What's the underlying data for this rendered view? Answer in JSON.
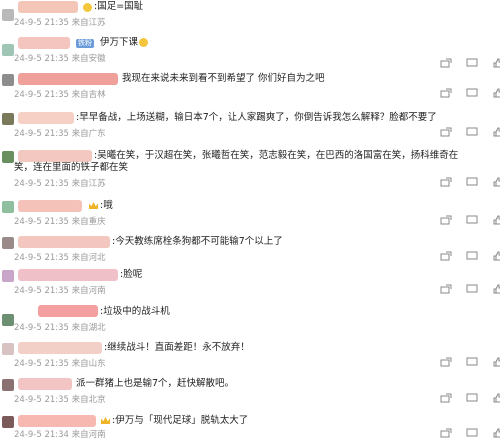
{
  "comments": [
    {
      "text": ":国足=国耻",
      "meta": "24-9-5 21:35 来自江苏",
      "avatar_color": "#b9b9b9",
      "blur_color": "#f3c6b8"
    },
    {
      "text": "伊万下课",
      "meta": "24-9-5 21:35 来自安徽",
      "avatar_color": "#9fc6b4",
      "blur_color": "#f4c4bf"
    },
    {
      "text": "我现在来说未来到看不到希望了 你们好自为之吧",
      "meta": "24-9-5 21:35 来自吉林",
      "avatar_color": "#8d8d8d",
      "blur_color": "#f0a09a"
    },
    {
      "text": ":早早备战，上场送糊，输日本7个，让人家踢爽了，你倒告诉我怎么解释？脸都不要了",
      "meta": "24-9-5 21:35 来自广东",
      "avatar_color": "#7a7a5a",
      "blur_color": "#f6d0c4"
    },
    {
      "text": ":吴曦在笑，于汉超在笑，张曦哲在笑，范志毅在笑，在巴西的洛国富在笑，扬科维奇在笑，连在里面的铁子都在笑",
      "meta": "24-9-5 21:35 来自江苏",
      "avatar_color": "#6a8f5e",
      "blur_color": "#f2c8c0"
    },
    {
      "text": ":哦",
      "meta": "24-9-5 21:35 来自重庆",
      "avatar_color": "#8fbf9f",
      "blur_color": "#f4c2b8"
    },
    {
      "text": ":今天教练席栓条狗都不可能输7个以上了",
      "meta": "24-9-5 21:35 来自河北",
      "avatar_color": "#9a8a8a",
      "blur_color": "#f3c7c0"
    },
    {
      "text": ":脸呢",
      "meta": "24-9-5 21:35 来自河南",
      "avatar_color": "#c9a6c9",
      "blur_color": "#f0c0c8"
    },
    {
      "text": ":垃圾中的战斗机",
      "meta": "24-9-5 21:35 来自湖北",
      "avatar_color": "#6f8f73",
      "blur_color": "#f5a0a0"
    },
    {
      "text": ":继续战斗！直面差距！永不放弃！",
      "meta": "24-9-5 21:35 来自山东",
      "avatar_color": "#d8c2c2",
      "blur_color": "#f2d0c8"
    },
    {
      "text": "派一群猪上也是输7个，赶快解散吧。",
      "meta": "24-9-5 21:35 来自北京",
      "avatar_color": "#8a7070",
      "blur_color": "#f3c4c4"
    },
    {
      "text": ":伊万与「现代足球」脱轨太大了",
      "meta": "24-9-5 21:34 来自河南",
      "avatar_color": "#7a5a5a",
      "blur_color": "#f6b8b0"
    }
  ],
  "badge_label": "铁粉",
  "icons": {
    "share": "share-icon",
    "comment": "comment-icon",
    "like": "like-icon"
  }
}
